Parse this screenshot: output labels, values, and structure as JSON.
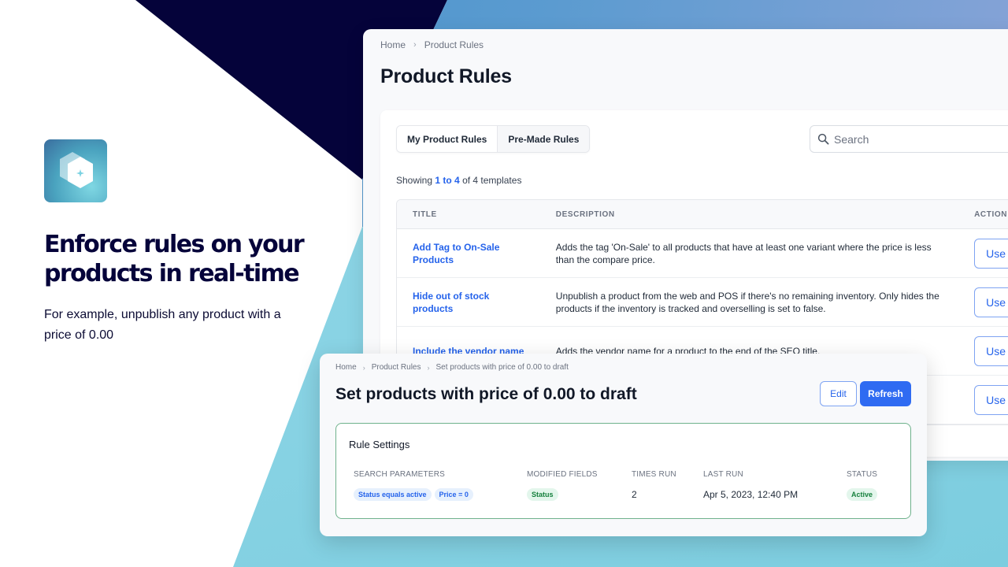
{
  "colors": {
    "navy": "#05033a",
    "accent_blue": "#2563eb",
    "primary_button": "#2f6bf2",
    "success_green": "#15803d",
    "settings_border": "#6fb28c"
  },
  "marketing": {
    "app_icon": "hexagon-sparkle-icon",
    "headline": "Enforce rules on your products in real-time",
    "subtext": "For example, unpublish any product with a price of 0.00"
  },
  "main": {
    "breadcrumb": [
      {
        "label": "Home"
      },
      {
        "label": "Product Rules"
      }
    ],
    "breadcrumb_separator": "›",
    "title": "Product Rules",
    "tabs": [
      {
        "label": "My Product Rules",
        "active": true
      },
      {
        "label": "Pre-Made Rules",
        "active": false
      }
    ],
    "search": {
      "placeholder": "Search",
      "value": ""
    },
    "showing": {
      "prefix": "Showing",
      "range": "1 to 4",
      "suffix": "of 4 templates"
    },
    "table": {
      "columns": [
        "TITLE",
        "DESCRIPTION",
        "ACTION"
      ],
      "rows": [
        {
          "title": "Add Tag to On-Sale Products",
          "description": "Adds the tag 'On-Sale' to all products that have at least one variant where the price is less than the compare price.",
          "action": "Use"
        },
        {
          "title": "Hide out of stock products",
          "description": "Unpublish a product from the web and POS if there's no remaining inventory. Only hides the products if the inventory is tracked and overselling is set to false.",
          "action": "Use"
        },
        {
          "title": "Include the vendor name",
          "description": "Adds the vendor name for a product to the end of the SEO title.",
          "action": "Use"
        },
        {
          "title": "",
          "description": "",
          "action": "Use"
        }
      ]
    }
  },
  "detail": {
    "breadcrumb": [
      {
        "label": "Home"
      },
      {
        "label": "Product Rules"
      },
      {
        "label": "Set products with price of 0.00 to draft"
      }
    ],
    "breadcrumb_separator": "›",
    "title": "Set products with price of 0.00 to draft",
    "edit_label": "Edit",
    "refresh_label": "Refresh",
    "settings": {
      "heading": "Rule Settings",
      "search_parameters": {
        "label": "SEARCH PARAMETERS",
        "tags": [
          "Status equals active",
          "Price = 0"
        ]
      },
      "modified_fields": {
        "label": "MODIFIED FIELDS",
        "tags": [
          "Status"
        ]
      },
      "times_run": {
        "label": "TIMES RUN",
        "value": "2"
      },
      "last_run": {
        "label": "LAST RUN",
        "value": "Apr 5, 2023, 12:40 PM"
      },
      "status": {
        "label": "STATUS",
        "value": "Active"
      }
    }
  }
}
